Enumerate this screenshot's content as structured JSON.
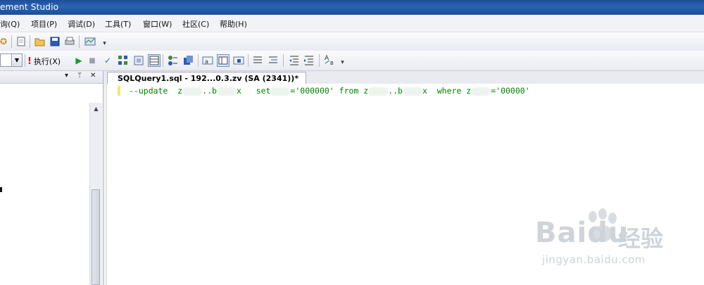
{
  "window": {
    "title": "ement Studio"
  },
  "menu": [
    "询(Q)",
    "项目(P)",
    "调试(D)",
    "工具(T)",
    "窗口(W)",
    "社区(C)",
    "帮助(H)"
  ],
  "toolbar": {
    "execute_label": "执行(X)"
  },
  "editor": {
    "tab_label": "SQLQuery1.sql - 192...0.3.zv (SA (2341))*",
    "code": {
      "p1": "--update  z",
      "p2": "..b",
      "p3": "x   set",
      "p4": "='000000' from z",
      "p5": "..b",
      "p6": "x  where z",
      "p7": "='00000'"
    }
  },
  "watermark": {
    "brand": "Baidu",
    "brand_cn": "经验",
    "url": "jingyan.baidu.com"
  }
}
